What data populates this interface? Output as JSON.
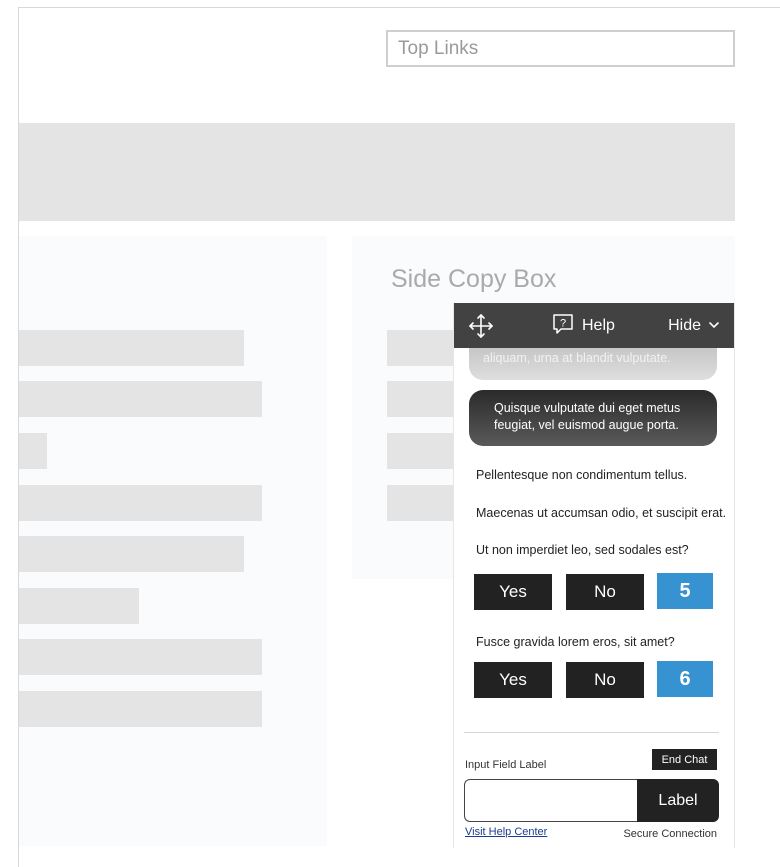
{
  "page": {
    "top_links": "Top Links",
    "side_copy_title": "Side Copy Box"
  },
  "chat": {
    "header": {
      "help_label": "Help",
      "hide_label": "Hide"
    },
    "messages": [
      {
        "from": "user",
        "text": "aliquam, urna at blandit vulputate."
      },
      {
        "from": "user",
        "text": "Quisque vulputate dui eget metus feugiat, vel euismod augue porta."
      },
      {
        "from": "agent",
        "text": "Pellentesque non condimentum tellus."
      },
      {
        "from": "agent",
        "text": "Maecenas ut accumsan odio, et suscipit erat."
      }
    ],
    "questions": [
      {
        "text": "Ut non imperdiet leo, sed sodales est?",
        "yes": "Yes",
        "no": "No",
        "badge": "5"
      },
      {
        "text": "Fusce gravida lorem eros, sit amet?",
        "yes": "Yes",
        "no": "No",
        "badge": "6"
      }
    ],
    "footer": {
      "input_label": "Input Field Label",
      "end_chat": "End Chat",
      "input_value": "",
      "send_label": "Label",
      "help_center_link": "Visit Help Center",
      "secure_text": "Secure Connection"
    }
  },
  "colors": {
    "header_bg": "#424242",
    "badge_blue": "#3792d2",
    "button_dark": "#222222",
    "placeholder_gray": "#e4e4e4"
  }
}
